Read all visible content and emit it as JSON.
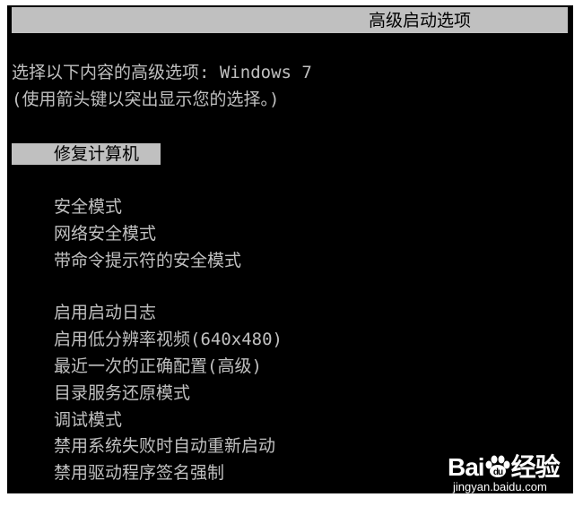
{
  "title": "高级启动选项",
  "header": {
    "line1": "选择以下内容的高级选项: Windows 7",
    "line2": "(使用箭头键以突出显示您的选择。)"
  },
  "selected_item": "修复计算机",
  "group1": [
    "安全模式",
    "网络安全模式",
    "带命令提示符的安全模式"
  ],
  "group2": [
    "启用启动日志",
    "启用低分辨率视频(640x480)",
    "最近一次的正确配置(高级)",
    "目录服务还原模式",
    "调试模式",
    "禁用系统失败时自动重新启动",
    "禁用驱动程序签名强制"
  ],
  "watermark": {
    "brand_left": "Bai",
    "brand_right": "经验",
    "url": "jingyan.baidu.com"
  },
  "colors": {
    "background": "#000000",
    "text": "#c0c0c0",
    "highlight": "#c0c0c0",
    "highlight_text": "#000000"
  }
}
